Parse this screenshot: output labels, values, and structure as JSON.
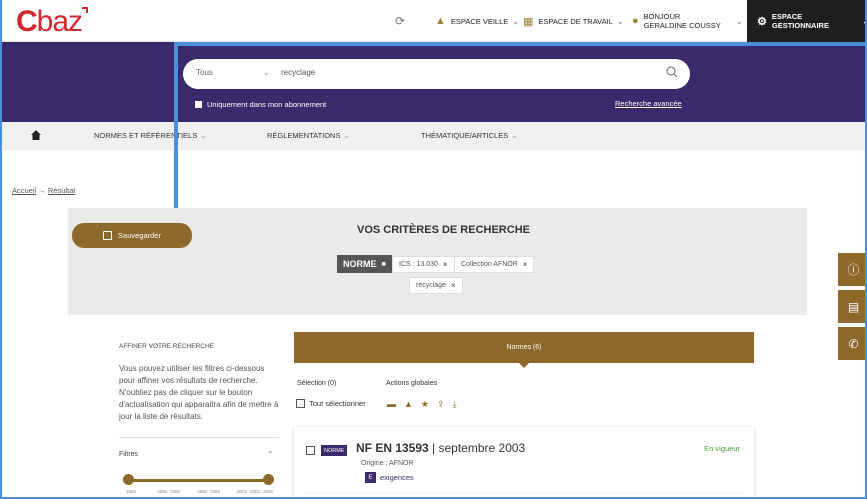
{
  "header": {
    "logo": "C",
    "logo_rest": "baz",
    "veille": "ESPACE VEILLE",
    "travail": "ESPACE DE TRAVAIL",
    "user_greeting": "BONJOUR",
    "user_name": "GERALDINE COUSSY",
    "gestionnaire": "ESPACE GESTIONNAIRE"
  },
  "search": {
    "scope": "Tous",
    "query": "recyclage",
    "subscription_only": "Uniquement dans mon abonnement",
    "advanced": "Recherche avancée"
  },
  "nav": {
    "items": [
      "NORMES ET RÉFÉRENTIELS",
      "RÉGLEMENTATIONS",
      "THÉMATIQUE/ARTICLES"
    ]
  },
  "breadcrumb": {
    "home": "Accueil",
    "arrow": "→",
    "current": "Résultat"
  },
  "criteria": {
    "save": "Sauvegarder",
    "title": "VOS CRITÈRES DE RECHERCHE",
    "tag": "NORME",
    "chips": [
      "ICS : 13.030",
      "Collection AFNOR",
      "recyclage"
    ]
  },
  "filters": {
    "title": "AFFINER VOTRE RECHERCHE",
    "help": "Vous pouvez utiliser les filtres ci-dessous pour affiner vos résultats de recherche. N'oubliez pas de cliquer sur le bouton d'actualisation qui apparaitra afin de mettre à jour la liste de résultats.",
    "filtres_label": "Filtres",
    "years": [
      "1992",
      "1995",
      "1996",
      "1998",
      "1999",
      "2001",
      "2002",
      "2003"
    ]
  },
  "results": {
    "tab": "Normes (6)",
    "selection": "Sélection (0)",
    "actions": "Actions globales",
    "select_all": "Tout sélectionner",
    "item": {
      "badge": "NORME",
      "ref": "NF EN 13593",
      "date": "| septembre 2003",
      "origin": "Origine : AFNOR",
      "kw_letter": "E",
      "keyword": "exigences",
      "status": "En vigueur"
    }
  },
  "colors": {
    "brand_red": "#d2272c",
    "purple": "#3a2a6b",
    "gold": "#8d6a2b",
    "green": "#4a9e3a"
  }
}
